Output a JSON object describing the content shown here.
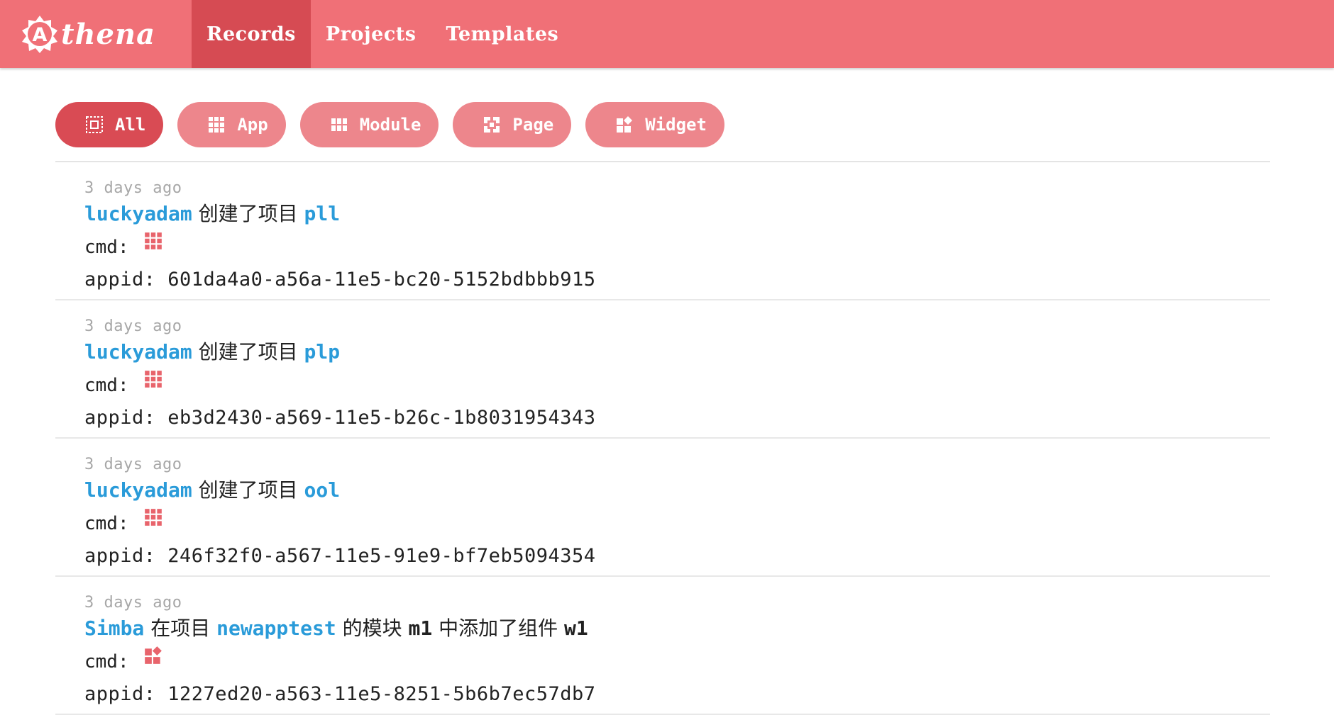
{
  "app": {
    "logo_text": "thena",
    "logo_letter": "A"
  },
  "nav": [
    {
      "label": "Records",
      "active": true
    },
    {
      "label": "Projects",
      "active": false
    },
    {
      "label": "Templates",
      "active": false
    }
  ],
  "filters": [
    {
      "label": "All",
      "icon": "select-all-icon",
      "active": true
    },
    {
      "label": "App",
      "icon": "apps-grid-icon",
      "active": false
    },
    {
      "label": "Module",
      "icon": "module-icon",
      "active": false
    },
    {
      "label": "Page",
      "icon": "page-icon",
      "active": false
    },
    {
      "label": "Widget",
      "icon": "widget-icon",
      "active": false
    }
  ],
  "records": [
    {
      "time": "3 days ago",
      "title": [
        {
          "t": "luckyadam",
          "c": "user"
        },
        {
          "t": " 创建了项目 ",
          "c": "plain"
        },
        {
          "t": "pll",
          "c": "proj"
        }
      ],
      "cmd_label": "cmd:",
      "cmd_icon": "apps-grid-icon",
      "appid": "appid: 601da4a0-a56a-11e5-bc20-5152bdbbb915"
    },
    {
      "time": "3 days ago",
      "title": [
        {
          "t": "luckyadam",
          "c": "user"
        },
        {
          "t": " 创建了项目 ",
          "c": "plain"
        },
        {
          "t": "plp",
          "c": "proj"
        }
      ],
      "cmd_label": "cmd:",
      "cmd_icon": "apps-grid-icon",
      "appid": "appid: eb3d2430-a569-11e5-b26c-1b8031954343"
    },
    {
      "time": "3 days ago",
      "title": [
        {
          "t": "luckyadam",
          "c": "user"
        },
        {
          "t": " 创建了项目 ",
          "c": "plain"
        },
        {
          "t": "ool",
          "c": "proj"
        }
      ],
      "cmd_label": "cmd:",
      "cmd_icon": "apps-grid-icon",
      "appid": "appid: 246f32f0-a567-11e5-91e9-bf7eb5094354"
    },
    {
      "time": "3 days ago",
      "title": [
        {
          "t": "Simba",
          "c": "user"
        },
        {
          "t": " 在项目 ",
          "c": "plain"
        },
        {
          "t": "newapptest",
          "c": "proj"
        },
        {
          "t": " 的模块 ",
          "c": "plain"
        },
        {
          "t": "m1",
          "c": "bold"
        },
        {
          "t": " 中添加了组件 ",
          "c": "plain"
        },
        {
          "t": "w1",
          "c": "bold"
        }
      ],
      "cmd_label": "cmd:",
      "cmd_icon": "widget-icon",
      "appid": "appid: 1227ed20-a563-11e5-8251-5b6b7ec57db7"
    }
  ]
}
